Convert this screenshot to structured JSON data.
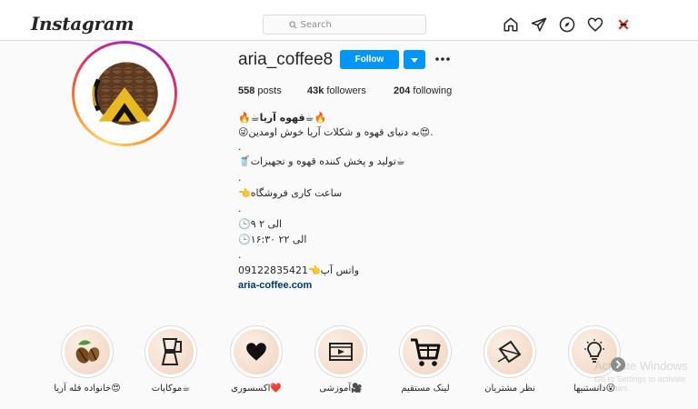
{
  "nav": {
    "logo": "Instagram",
    "search_placeholder": "Search",
    "icons": [
      "home-icon",
      "direct-message-icon",
      "explore-compass-icon",
      "activity-heart-icon",
      "profile-avatar-icon"
    ]
  },
  "profile": {
    "username": "aria_coffee8",
    "follow_label": "Follow",
    "stats": {
      "posts_count": "558",
      "posts_label": "posts",
      "followers_count": "43k",
      "followers_label": "followers",
      "following_count": "204",
      "following_label": "following"
    },
    "bio": {
      "name": "🔥☕قهوه آریا☕🔥",
      "line1": "😜به دنیای قهوه و شکلات آریا خوش اومدین😍.",
      "dot1": ".",
      "line2": "🥤تولید و پخش کننده قهوه و تجهیزات☕",
      "dot2": ".",
      "line3": "👈ساعت کاری فروشگاه",
      "dot3": ".",
      "line4": "🕒۹ الی ۲",
      "line5": "🕒۱۶:۳۰ الی ۲۲",
      "dot4": ".",
      "phone": "واتس آپ👈09122835421",
      "link": "aria-coffee.com"
    }
  },
  "highlights": [
    {
      "label": "😍خانواده فله آریا",
      "icon": "coffee-beans-icon"
    },
    {
      "label": "☕موکاپات",
      "icon": "moka-pot-icon"
    },
    {
      "label": "❤️اکسسوری",
      "icon": "heart-icon"
    },
    {
      "label": "🎥آموزشی",
      "icon": "video-film-icon"
    },
    {
      "label": "لینک مستقیم",
      "icon": "shopping-cart-icon"
    },
    {
      "label": "نظر مشتریان",
      "icon": "message-envelope-icon"
    },
    {
      "label": "😮دانستنیها",
      "icon": "lightbulb-icon"
    }
  ],
  "watermark": {
    "title": "Activate Windows",
    "subtitle": "Go to Settings to activate Windows."
  }
}
